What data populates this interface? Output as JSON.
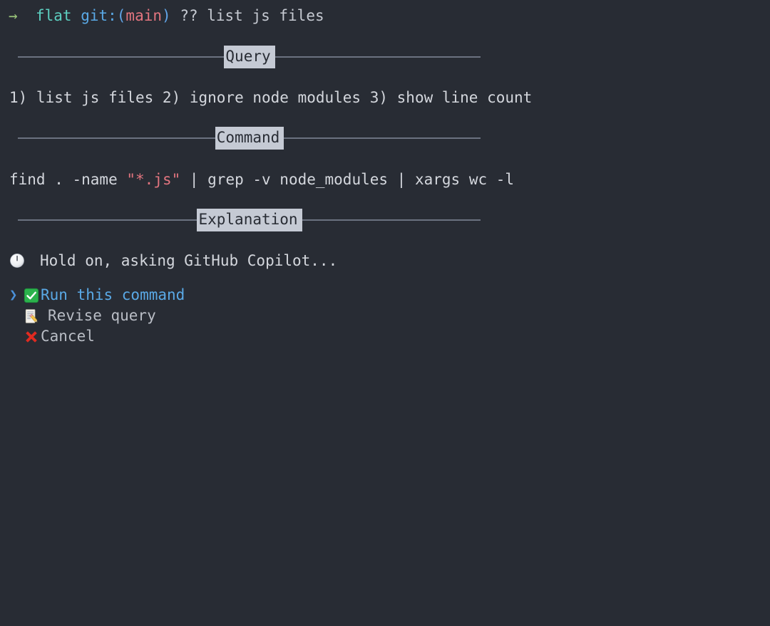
{
  "terminal": {
    "background_color": "#282c34",
    "foreground_color": "#d4d7dd"
  },
  "prompt": {
    "arrow": "→",
    "directory": "flat",
    "git_label": "git:",
    "paren_open": "(",
    "branch": "main",
    "paren_close": ")",
    "command": "?? list js files",
    "colors": {
      "arrow": "#98c379",
      "directory": "#5ccfc0",
      "git_label": "#5aa9e6",
      "paren": "#61a5e8",
      "branch": "#e2757f",
      "command": "#c6cad2"
    }
  },
  "sections": {
    "query": {
      "badge": "Query",
      "body": "1) list js files 2) ignore node modules 3) show line count"
    },
    "command": {
      "badge": "Command",
      "body_prefix": "find . -name ",
      "body_string": "\"*.js\"",
      "body_suffix": " | grep -v node_modules | xargs wc -l",
      "string_color": "#e2757f"
    },
    "explanation": {
      "badge": "Explanation",
      "status_icon": "clock-icon",
      "status_text": "Hold on, asking GitHub Copilot..."
    }
  },
  "menu": {
    "chevron": "❯",
    "selected_index": 0,
    "items": [
      {
        "icon": "check-mark-button-icon",
        "label": "Run this command",
        "selected": true
      },
      {
        "icon": "memo-icon",
        "label": "Revise query",
        "selected": false
      },
      {
        "icon": "cross-mark-icon",
        "label": "Cancel",
        "selected": false
      }
    ],
    "selected_color": "#5aa9e6",
    "unselected_color": "#b9bdc5"
  }
}
